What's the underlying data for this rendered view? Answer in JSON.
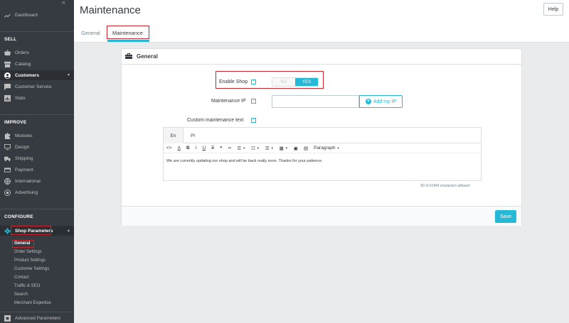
{
  "sidebar": {
    "collapse_icon": "double-chevron-left-icon",
    "dashboard": "Dashboard",
    "sections": {
      "sell": "SELL",
      "improve": "IMPROVE",
      "configure": "CONFIGURE"
    },
    "sell_items": [
      "Orders",
      "Catalog",
      "Customers",
      "Customer Service",
      "Stats"
    ],
    "improve_items": [
      "Modules",
      "Design",
      "Shipping",
      "Payment",
      "International",
      "Advertising"
    ],
    "shop_parameters": "Shop Parameters",
    "shop_sub_items": [
      "General",
      "Order Settings",
      "Product Settings",
      "Customer Settings",
      "Contact",
      "Traffic & SEO",
      "Search",
      "Merchant Expertise"
    ],
    "advanced_parameters": "Advanced Parameters"
  },
  "header": {
    "title": "Maintenance",
    "help_label": "Help",
    "tabs": [
      "General",
      "Maintenance"
    ]
  },
  "card": {
    "title": "General",
    "enable_shop_label": "Enable Shop",
    "switch_no": "NO",
    "switch_yes": "YES",
    "maintenance_ip_label": "Maintenance IP",
    "maintenance_ip_value": "",
    "add_ip_label": "Add my IP",
    "custom_text_label": "Custom maintenance text",
    "help_mark": "?",
    "lang_tabs": [
      "En",
      "Pl"
    ],
    "paragraph_label": "Paragraph",
    "editor_text": "We are currently updating our shop and will be back really soon. Thanks for your patience.",
    "char_count": "90 of 21844 characters allowed",
    "save_label": "Save"
  },
  "colors": {
    "sidebar_bg": "#363a41",
    "accent": "#25b9d7",
    "highlight": "#c8252d"
  }
}
